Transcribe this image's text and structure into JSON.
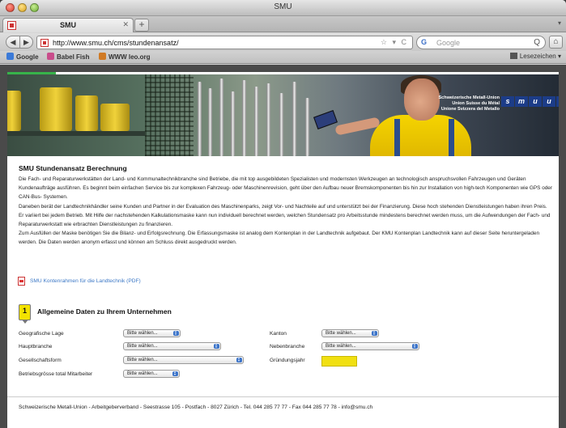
{
  "window": {
    "title": "SMU"
  },
  "tab": {
    "label": "SMU",
    "close": "✕",
    "new_tab": "+",
    "menu": "▾"
  },
  "nav": {
    "back": "◀",
    "forward": "▶",
    "url": "http://www.smu.ch/cms/stundenansatz/",
    "url_icons": "☆ ▾ C",
    "search_engine": "G",
    "search_placeholder": "Google",
    "search_glass": "Q",
    "home": "⌂"
  },
  "bookmarks": {
    "items": [
      "Google",
      "Babel Fish",
      "WWW leo.org"
    ],
    "right": "Lesezeichen ▾"
  },
  "banner": {
    "logo_text_lines": [
      "Schweizerische Metall-Union",
      "Union Suisse du Métal",
      "Unione Svizzera del Metallo"
    ],
    "logo_letters": [
      "s",
      "m",
      "u",
      "u",
      "s",
      "m"
    ]
  },
  "content": {
    "title": "SMU Stundenansatz Berechnung",
    "paragraphs": [
      "Die Fach- und Reparaturwerkstätten der Land- und Kommunaltechnikbranche sind Betriebe, die mit top ausgebildeten Spezialisten und modernsten Werkzeugen an technologisch anspruchsvollen Fahrzeugen und Geräten Kundenaufträge ausführen. Es beginnt beim einfachen Service bis zur komplexen Fahrzeug- oder Maschinenrevision, geht über den Aufbau neuer Bremskomponenten bis hin zur Installation von high-tech Komponenten wie GPS oder CAN-Bus- Systemen.",
      "Daneben berät der Landtechnikhändler seine Kunden und Partner in der Evaluation des Maschinenparks, zeigt Vor- und Nachteile auf und unterstützt bei der Finanzierung. Diese hoch stehenden Dienstleistungen haben ihren Preis. Er variiert bei jedem Betrieb. Mit Hilfe der nachstehenden Kalkulationsmaske kann nun individuell berechnet werden, welchen Stundensatz pro Arbeitsstunde mindestens berechnet werden muss, um die Aufwendungen der Fach- und Reparaturwerkstatt wie erbrachten Dienstleistungen zu finanzieren.",
      "Zum Ausfüllen der Maske benötigen Sie die Bilanz- und Erfolgsrechnung. Die Erfassungsmaske ist analog dem Kontenplan in der Landtechnik aufgebaut. Der KMU Kontenplan Landtechnik kann auf dieser Seite heruntergeladen werden. Die Daten werden anonym erfasst und können am Schluss direkt ausgedruckt werden."
    ],
    "pdf_link": "SMU Kontenrahmen für die Landtechnik (PDF)"
  },
  "section": {
    "number": "1",
    "title": "Allgemeine Daten zu Ihrem Unternehmen"
  },
  "form": {
    "geografische_lage": {
      "label": "Geografische Lage",
      "value": "Bitte wählen..."
    },
    "hauptbranche": {
      "label": "Hauptbranche",
      "value": "Bitte wählen..."
    },
    "gesellschaftsform": {
      "label": "Gesellschaftsform",
      "value": "Bitte wählen..."
    },
    "betriebsgroesse": {
      "label": "Betriebsgrösse total Mitarbeiter",
      "value": "Bitte wählen..."
    },
    "kanton": {
      "label": "Kanton",
      "value": "Bitte wählen..."
    },
    "nebenbranche": {
      "label": "Nebenbranche",
      "value": "Bitte wählen..."
    },
    "gruendungsjahr": {
      "label": "Gründungsjahr",
      "value": ""
    }
  },
  "footer": {
    "text": "Schweizerische Metall-Union - Arbeitgeberverband - Seestrasse 105 - Postfach - 8027 Zürich - Tel. 044 285 77 77 - Fax 044 285 77 78 - info@smu.ch"
  },
  "colors": {
    "accent_green": "#37b34a",
    "step_yellow": "#f3e200",
    "link_blue": "#3c78c6",
    "select_arrow_blue": "#3c74c9"
  }
}
